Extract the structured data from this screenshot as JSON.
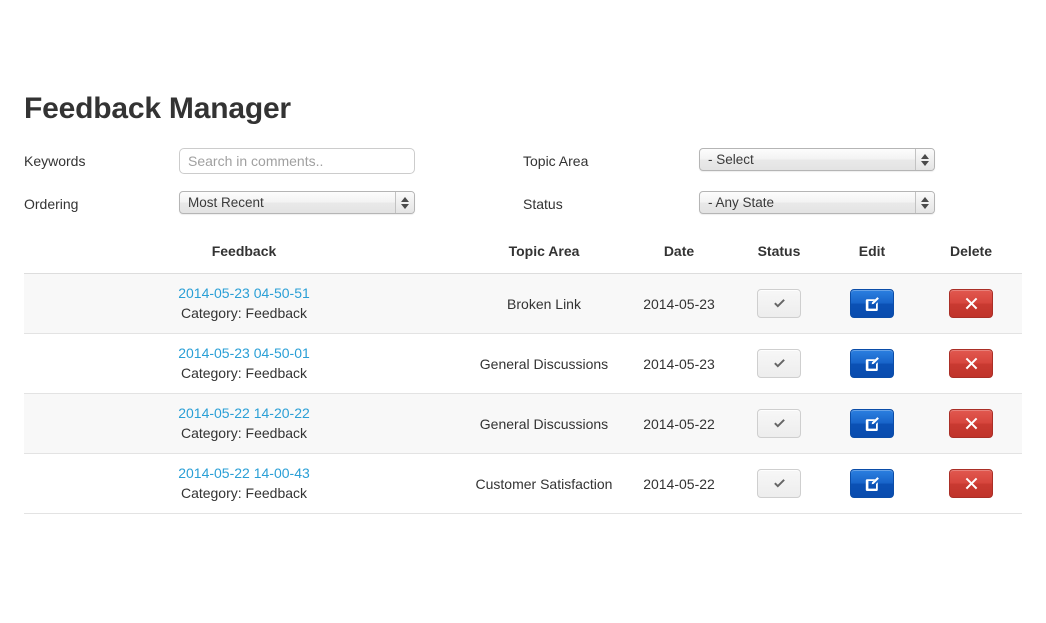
{
  "page": {
    "title": "Feedback Manager"
  },
  "filters": {
    "keywords": {
      "label": "Keywords",
      "placeholder": "Search in comments..",
      "value": ""
    },
    "ordering": {
      "label": "Ordering",
      "selected": "Most Recent"
    },
    "topic_area": {
      "label": "Topic Area",
      "selected": "- Select"
    },
    "status": {
      "label": "Status",
      "selected": "- Any State"
    }
  },
  "table": {
    "headers": {
      "feedback": "Feedback",
      "topic_area": "Topic Area",
      "date": "Date",
      "status": "Status",
      "edit": "Edit",
      "delete": "Delete"
    },
    "rows": [
      {
        "link": "2014-05-23 04-50-51",
        "category": "Category: Feedback",
        "topic_area": "Broken Link",
        "date": "2014-05-23",
        "status_icon": "check-icon",
        "edit_icon": "edit-pencil-square-icon",
        "delete_icon": "close-x-icon"
      },
      {
        "link": "2014-05-23 04-50-01",
        "category": "Category: Feedback",
        "topic_area": "General Discussions",
        "date": "2014-05-23",
        "status_icon": "check-icon",
        "edit_icon": "edit-pencil-square-icon",
        "delete_icon": "close-x-icon"
      },
      {
        "link": "2014-05-22 14-20-22",
        "category": "Category: Feedback",
        "topic_area": "General Discussions",
        "date": "2014-05-22",
        "status_icon": "check-icon",
        "edit_icon": "edit-pencil-square-icon",
        "delete_icon": "close-x-icon"
      },
      {
        "link": "2014-05-22 14-00-43",
        "category": "Category: Feedback",
        "topic_area": "Customer Satisfaction",
        "date": "2014-05-22",
        "status_icon": "check-icon",
        "edit_icon": "edit-pencil-square-icon",
        "delete_icon": "close-x-icon"
      }
    ]
  },
  "colors": {
    "link": "#2a9fd6",
    "edit_button": "#1763c8",
    "delete_button": "#d6453c",
    "status_button": "#ededed",
    "text": "#333333",
    "stripe": "#f8f8f8"
  }
}
